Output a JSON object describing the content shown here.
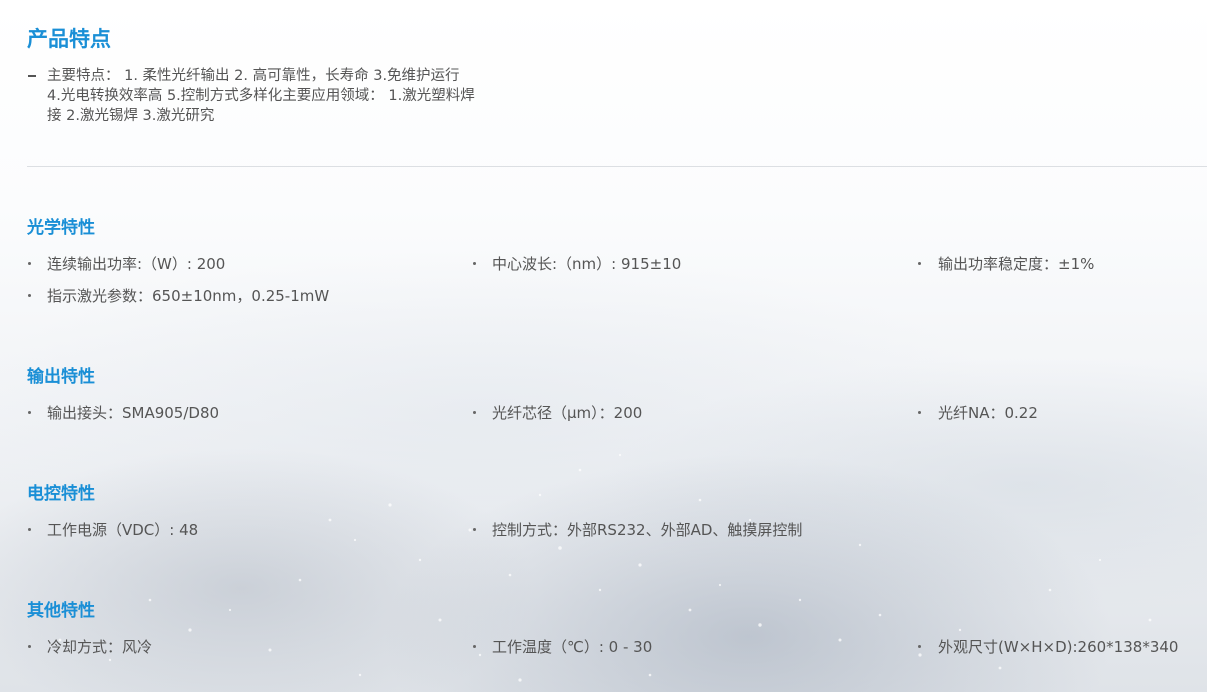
{
  "product_features": {
    "title": "产品特点",
    "text": "主要特点： 1. 柔性光纤输出 2. 高可靠性，长寿命 3.免维护运行 4.光电转换效率高 5.控制方式多样化主要应用领域： 1.激光塑料焊接 2.激光锡焊 3.激光研究"
  },
  "sections": [
    {
      "title": "光学特性",
      "items": [
        "连续输出功率:（W）: 200",
        "中心波长:（nm）: 915±10",
        "输出功率稳定度：±1%",
        "指示激光参数：650±10nm，0.25-1mW"
      ]
    },
    {
      "title": "输出特性",
      "items": [
        "输出接头：SMA905/D80",
        "光纤芯径（μm）：200",
        "光纤NA：0.22"
      ]
    },
    {
      "title": "电控特性",
      "items": [
        "工作电源（VDC）: 48",
        "控制方式：外部RS232、外部AD、触摸屏控制"
      ]
    },
    {
      "title": "其他特性",
      "items": [
        "冷却方式：风冷",
        "工作温度（℃）: 0 - 30",
        "外观尺寸(W×H×D):260*138*340"
      ]
    }
  ]
}
